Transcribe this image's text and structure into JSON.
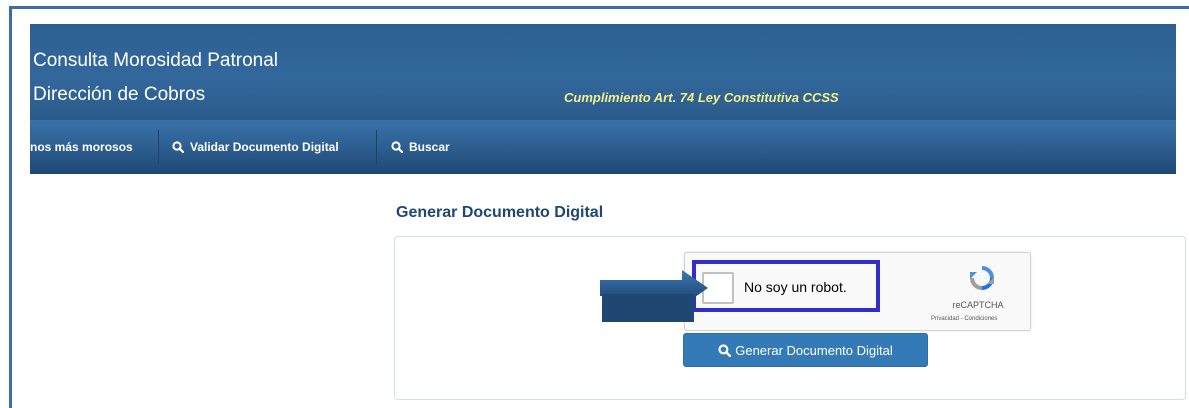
{
  "header": {
    "title": "Consulta Morosidad Patronal",
    "subtitle": "Dirección de Cobros",
    "law_note": "Cumplimiento Art. 74 Ley Constitutiva CCSS"
  },
  "nav": {
    "items": [
      {
        "label": "nos más morosos",
        "icon": null
      },
      {
        "label": "Validar Documento Digital",
        "icon": "search-icon"
      },
      {
        "label": "Buscar",
        "icon": "search-icon"
      }
    ]
  },
  "main": {
    "section_title": "Generar Documento Digital",
    "captcha": {
      "label": "No soy un robot.",
      "brand": "reCAPTCHA",
      "links": "Privacidad - Condiciones",
      "checked": false
    },
    "generate_button": {
      "label": "Generar Documento Digital",
      "icon": "search-icon"
    }
  },
  "colors": {
    "header_blue": "#2c5f92",
    "law_note_yellow": "#f5ef8a",
    "button_blue": "#337ab7",
    "highlight": "#3030c8",
    "arrow": "#1f4772"
  }
}
